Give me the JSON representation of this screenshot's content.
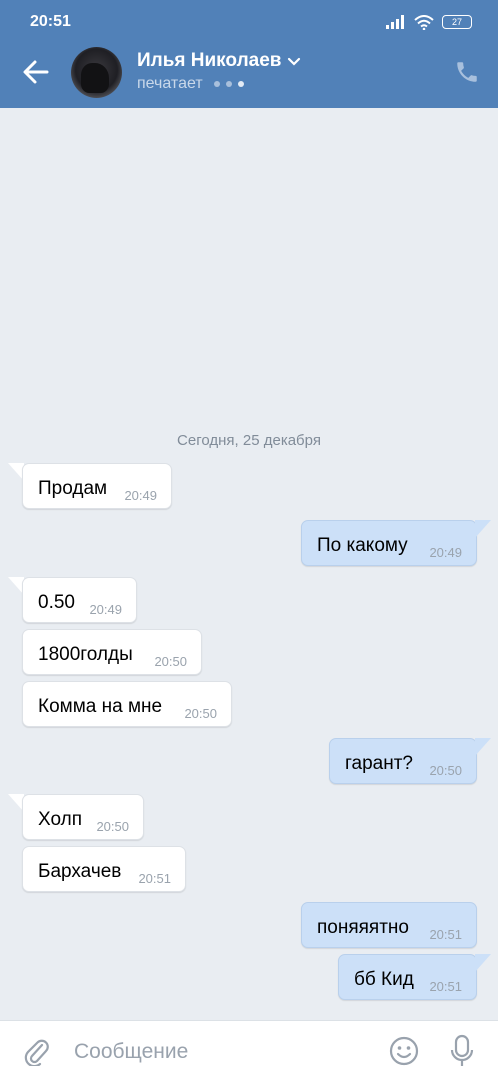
{
  "status": {
    "time": "20:51",
    "battery": "27"
  },
  "header": {
    "name": "Илья Николаев",
    "status": "печатает"
  },
  "chat": {
    "date_separator": "Сегодня, 25 декабря",
    "messages": [
      {
        "dir": "in",
        "text": "Продам",
        "time": "20:49"
      },
      {
        "dir": "out",
        "text": "По какому",
        "time": "20:49"
      },
      {
        "dir": "in",
        "text": "0.50",
        "time": "20:49"
      },
      {
        "dir": "in",
        "text": "1800голды",
        "time": "20:50"
      },
      {
        "dir": "in",
        "text": "Комма на мне",
        "time": "20:50"
      },
      {
        "dir": "out",
        "text": "гарант?",
        "time": "20:50"
      },
      {
        "dir": "in",
        "text": "Холп",
        "time": "20:50"
      },
      {
        "dir": "in",
        "text": "Бархачев",
        "time": "20:51"
      },
      {
        "dir": "out",
        "text": "поняяятно",
        "time": "20:51"
      },
      {
        "dir": "out",
        "text": "бб Кид",
        "time": "20:51"
      }
    ]
  },
  "input": {
    "placeholder": "Сообщение"
  },
  "colors": {
    "header": "#5181b8",
    "background": "#e9edf2",
    "outgoing": "#cce0f8",
    "incoming": "#ffffff"
  }
}
